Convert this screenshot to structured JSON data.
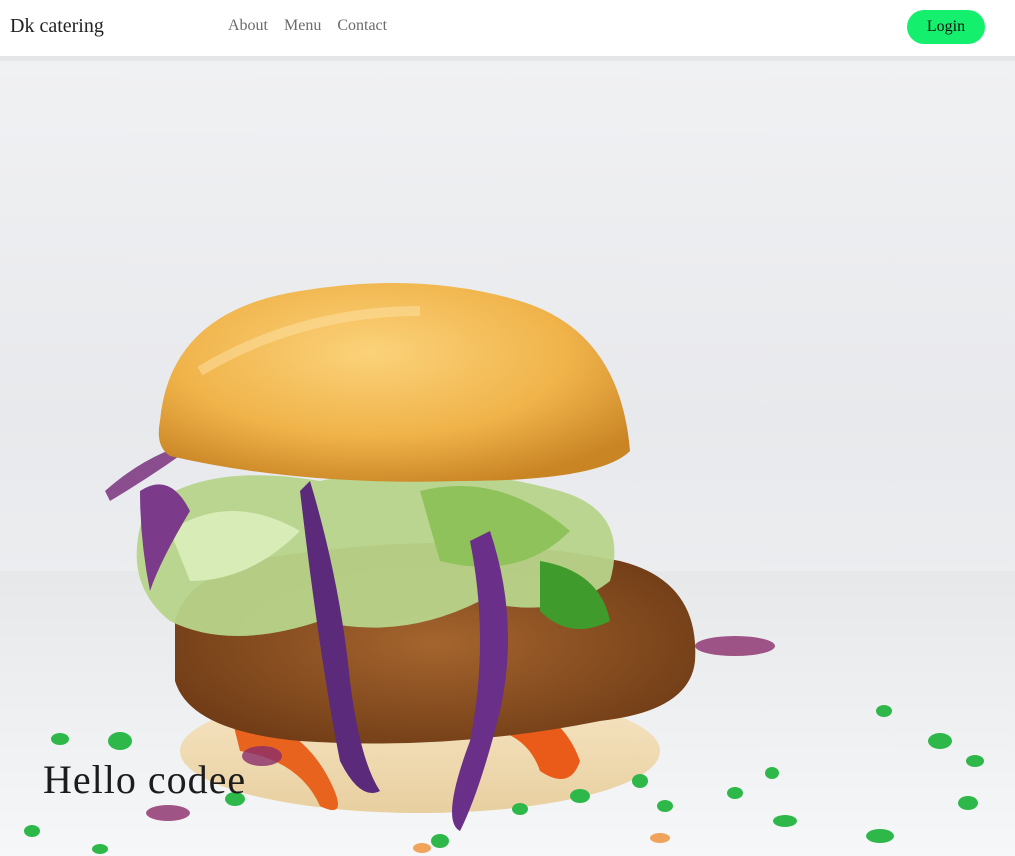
{
  "navbar": {
    "brand": "Dk catering",
    "links": [
      "About",
      "Menu",
      "Contact"
    ],
    "login_label": "Login",
    "login_color": "#14f06e"
  },
  "hero": {
    "image": "burger-photo",
    "title": "Hello codee"
  }
}
